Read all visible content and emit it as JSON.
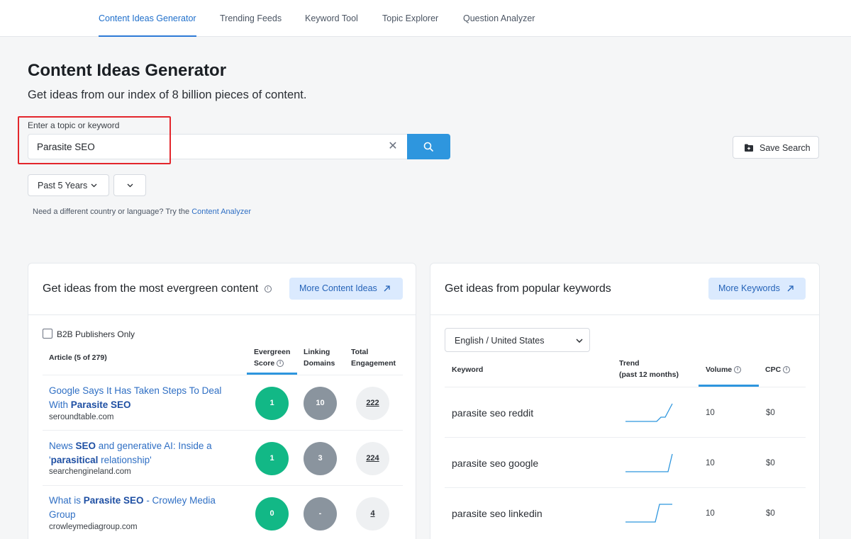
{
  "nav": {
    "tabs": [
      {
        "label": "Content Ideas Generator",
        "active": true
      },
      {
        "label": "Trending Feeds"
      },
      {
        "label": "Keyword Tool"
      },
      {
        "label": "Topic Explorer"
      },
      {
        "label": "Question Analyzer"
      }
    ]
  },
  "page": {
    "title": "Content Ideas Generator",
    "subtitle": "Get ideas from our index of 8 billion pieces of content."
  },
  "search": {
    "label": "Enter a topic or keyword",
    "value": "Parasite SEO"
  },
  "save_button": "Save Search",
  "filters": {
    "time_range": "Past 5 Years"
  },
  "help": {
    "text": "Need a different country or language? Try the ",
    "link": "Content Analyzer"
  },
  "evergreen": {
    "title": "Get ideas from the most evergreen content",
    "more_button": "More Content Ideas",
    "checkbox_label": "B2B Publishers Only",
    "columns": {
      "article": "Article (5 of 279)",
      "evergreen_1": "Evergreen",
      "evergreen_2": "Score",
      "linking_1": "Linking",
      "linking_2": "Domains",
      "engagement_1": "Total",
      "engagement_2": "Engagement"
    },
    "rows": [
      {
        "title_before": "Google Says It Has Taken Steps To Deal With ",
        "title_bold": "Parasite SEO",
        "title_after": "",
        "domain": "seroundtable.com",
        "evergreen": "1",
        "linking": "10",
        "engagement": "222"
      },
      {
        "title_before": "News ",
        "title_bold": "SEO",
        "title_after": " and generative AI: Inside a '",
        "title_bold2": "parasitical",
        "title_after2": " relationship'",
        "domain": "searchengineland.com",
        "evergreen": "1",
        "linking": "3",
        "engagement": "224"
      },
      {
        "title_before": "What is ",
        "title_bold": "Parasite SEO",
        "title_after": " - Crowley Media Group",
        "domain": "crowleymediagroup.com",
        "evergreen": "0",
        "linking": "-",
        "engagement": "4"
      }
    ]
  },
  "keywords": {
    "title": "Get ideas from popular keywords",
    "more_button": "More Keywords",
    "language": "English / United States",
    "columns": {
      "keyword": "Keyword",
      "trend_1": "Trend",
      "trend_2": "(past 12 months)",
      "volume": "Volume",
      "cpc": "CPC"
    },
    "rows": [
      {
        "keyword": "parasite seo reddit",
        "volume": "10",
        "cpc": "$0"
      },
      {
        "keyword": "parasite seo google",
        "volume": "10",
        "cpc": "$0"
      },
      {
        "keyword": "parasite seo linkedin",
        "volume": "10",
        "cpc": "$0"
      }
    ]
  },
  "colors": {
    "accent": "#2e96de",
    "link": "#2f6fc4",
    "evergreen_green": "#12b886",
    "highlight_red": "#e3262c"
  }
}
